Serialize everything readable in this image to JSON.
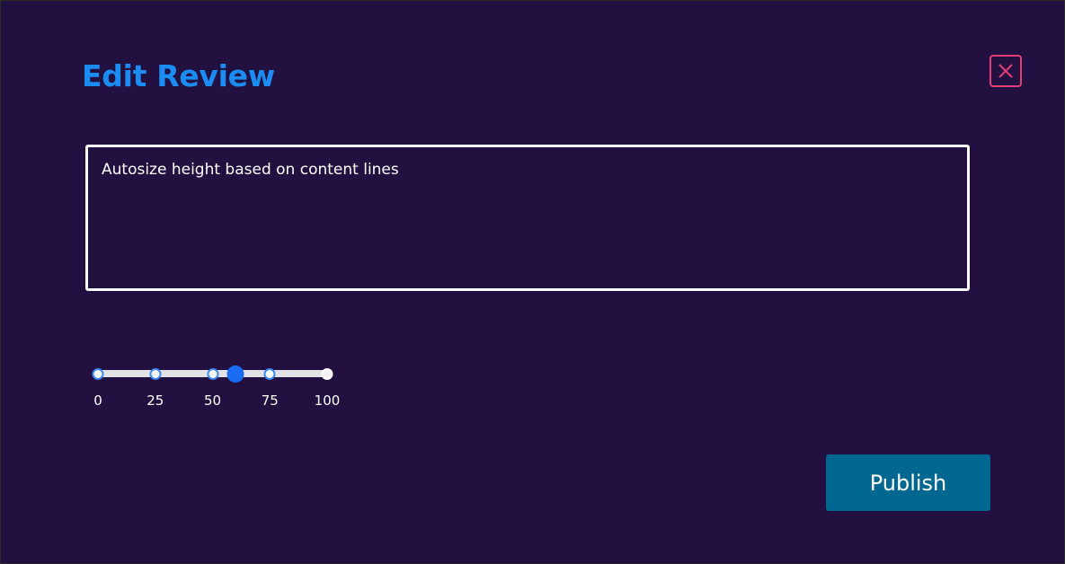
{
  "dialog": {
    "title": "Edit Review",
    "close_icon": "close-icon"
  },
  "review": {
    "value": "Autosize height based on content lines"
  },
  "rating_slider": {
    "min": 0,
    "max": 100,
    "value": 60,
    "ticks": [
      {
        "value": 0,
        "label": "0"
      },
      {
        "value": 25,
        "label": "25"
      },
      {
        "value": 50,
        "label": "50"
      },
      {
        "value": 75,
        "label": "75"
      },
      {
        "value": 100,
        "label": "100"
      }
    ]
  },
  "actions": {
    "publish_label": "Publish"
  },
  "colors": {
    "background": "#221040",
    "title": "#1a8cf2",
    "close_border": "#e23d77",
    "slider_handle": "#1a6cf5",
    "publish_button": "#006890"
  }
}
